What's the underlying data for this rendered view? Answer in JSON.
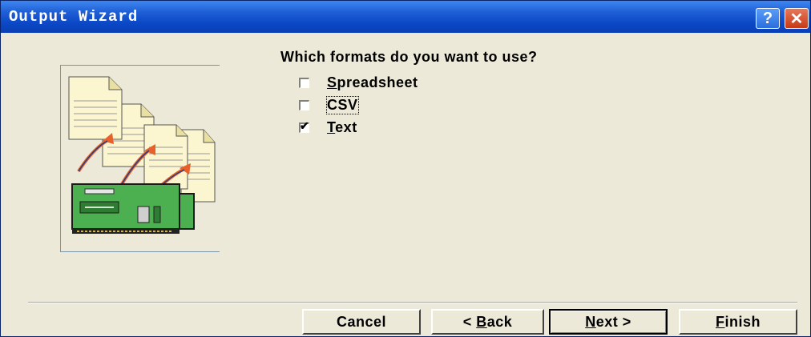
{
  "window": {
    "title": "Output Wizard"
  },
  "titlebar": {
    "help_glyph": "?",
    "close_glyph": "✕"
  },
  "question": "Which formats do you want to use?",
  "options": [
    {
      "mnemonic": "S",
      "rest": "preadsheet",
      "checked": false
    },
    {
      "mnemonic": "",
      "rest": "CSV",
      "checked": false
    },
    {
      "mnemonic": "T",
      "rest": "ext",
      "checked": true
    }
  ],
  "buttons": {
    "cancel": {
      "pre": "Cancel",
      "mn": "",
      "post": ""
    },
    "back": {
      "pre": "< ",
      "mn": "B",
      "post": "ack"
    },
    "next": {
      "pre": "",
      "mn": "N",
      "post": "ext >"
    },
    "finish": {
      "pre": "",
      "mn": "F",
      "post": "inish"
    }
  },
  "colors": {
    "titlebar": "#0b48c6",
    "face": "#ece9d8",
    "chip_green": "#4caf50",
    "arrow_orange": "#e8602a"
  },
  "icons": {
    "illustration": "documents-to-chip-illustration",
    "check": "checkmark"
  }
}
